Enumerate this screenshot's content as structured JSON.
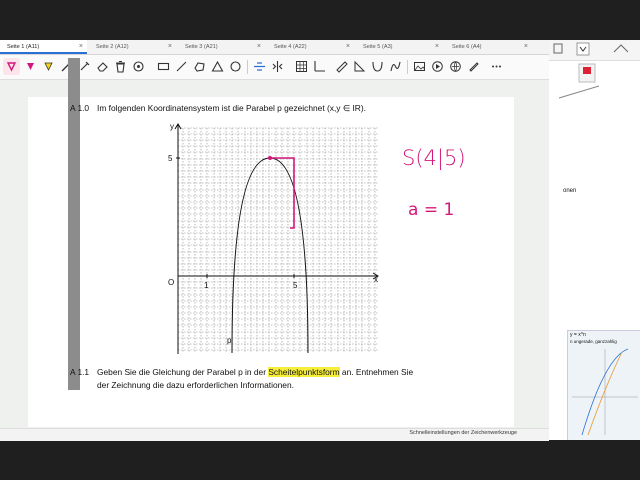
{
  "tabs": [
    {
      "label": "Seite 1 (A11)",
      "active": true
    },
    {
      "label": "Seite 2 (A12)",
      "active": false
    },
    {
      "label": "Seite 3 (A21)",
      "active": false
    },
    {
      "label": "Seite 4 (A22)",
      "active": false
    },
    {
      "label": "Seite 5 (A3)",
      "active": false
    },
    {
      "label": "Seite 6 (A4)",
      "active": false
    }
  ],
  "tools": [
    "lasso-icon",
    "pen-icon",
    "highlighter-icon",
    "magic-wand-icon",
    "shape-pen-icon",
    "eraser-icon",
    "trash-icon",
    "color-circle-icon",
    "rectangle-icon",
    "line-icon",
    "ellipse-icon",
    "triangle-icon",
    "circle-icon",
    "align-icon",
    "mirror-icon",
    "table-icon",
    "axis-icon",
    "ruler-icon",
    "triangle-ruler-icon",
    "parabola-icon",
    "function-icon",
    "image-icon",
    "video-icon",
    "link-icon",
    "more-icon"
  ],
  "task_a10": {
    "label": "A 1.0",
    "text_before": "Im folgenden Koordinatensystem ist die Parabel p gezeichnet",
    "domain": "(x,y ∈ IR)."
  },
  "task_a11": {
    "label": "A 1.1",
    "line1_before": "Geben Sie die Gleichung der Parabel p in der",
    "highlight": "Scheitelpunktsform",
    "line1_after": "an. Entnehmen Sie",
    "line2": "der Zeichnung die dazu erforderlichen Informationen."
  },
  "handwriting": {
    "vertex": "S(4|5)",
    "a_value": "a = 1"
  },
  "graph": {
    "y_axis_label": "y",
    "x_axis_label": "x",
    "origin_label": "O",
    "x_tick_1": "1",
    "x_tick_5": "5",
    "y_tick_5": "5",
    "curve_label": "p"
  },
  "status_text": "Schnelleinstellungen der Zeichenwerkzeuge",
  "side_panel": {
    "formula": "y = x^n",
    "caption": "n ungerade, ganzzahlig",
    "word": "onen"
  },
  "colors": {
    "ink": "#d4177a",
    "highlight": "#f7ee3c",
    "accent": "#2a6fd6"
  }
}
